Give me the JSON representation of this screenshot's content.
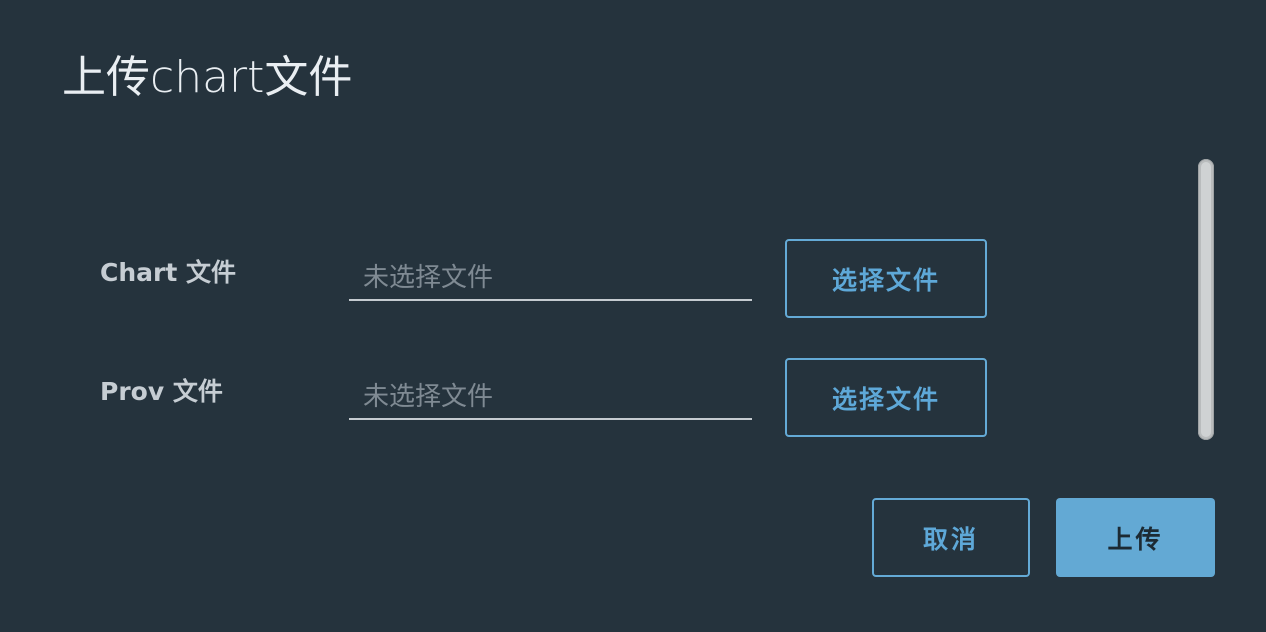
{
  "dialog": {
    "title": "上传chart文件"
  },
  "form": {
    "chart": {
      "label": "Chart 文件",
      "placeholder": "未选择文件",
      "value": "",
      "button_label": "选择文件"
    },
    "prov": {
      "label": "Prov 文件",
      "placeholder": "未选择文件",
      "value": "",
      "button_label": "选择文件"
    }
  },
  "footer": {
    "cancel_label": "取消",
    "upload_label": "上传"
  },
  "colors": {
    "background": "#25333d",
    "accent": "#63a9d4",
    "text": "#c6cdd3"
  }
}
